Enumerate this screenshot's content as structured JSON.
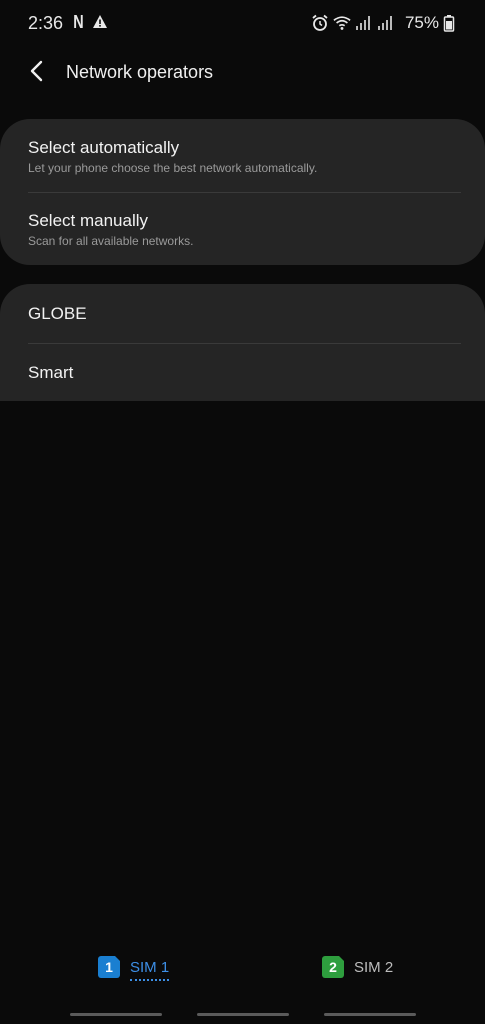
{
  "status_bar": {
    "time": "2:36",
    "netflix_glyph": "N",
    "battery_text": "75%",
    "icons": [
      "netflix-icon",
      "warning-icon",
      "alarm-icon",
      "wifi-icon",
      "signal-icon",
      "signal-icon",
      "battery-icon"
    ]
  },
  "header": {
    "title": "Network operators",
    "back_icon": "chevron-left-icon"
  },
  "selection_group": {
    "items": [
      {
        "title": "Select automatically",
        "subtitle": "Let your phone choose the best network automatically."
      },
      {
        "title": "Select manually",
        "subtitle": "Scan for all available networks."
      }
    ]
  },
  "operators": {
    "items": [
      {
        "title": "GLOBE"
      },
      {
        "title": "Smart"
      }
    ]
  },
  "sim_tabs": {
    "tabs": [
      {
        "number": "1",
        "label": "SIM 1",
        "color": "#1a7fd1",
        "selected": true
      },
      {
        "number": "2",
        "label": "SIM 2",
        "color": "#2e9e3e",
        "selected": false
      }
    ]
  },
  "colors": {
    "background": "#0a0a0a",
    "card": "#252525",
    "accent": "#3d8fe6"
  }
}
